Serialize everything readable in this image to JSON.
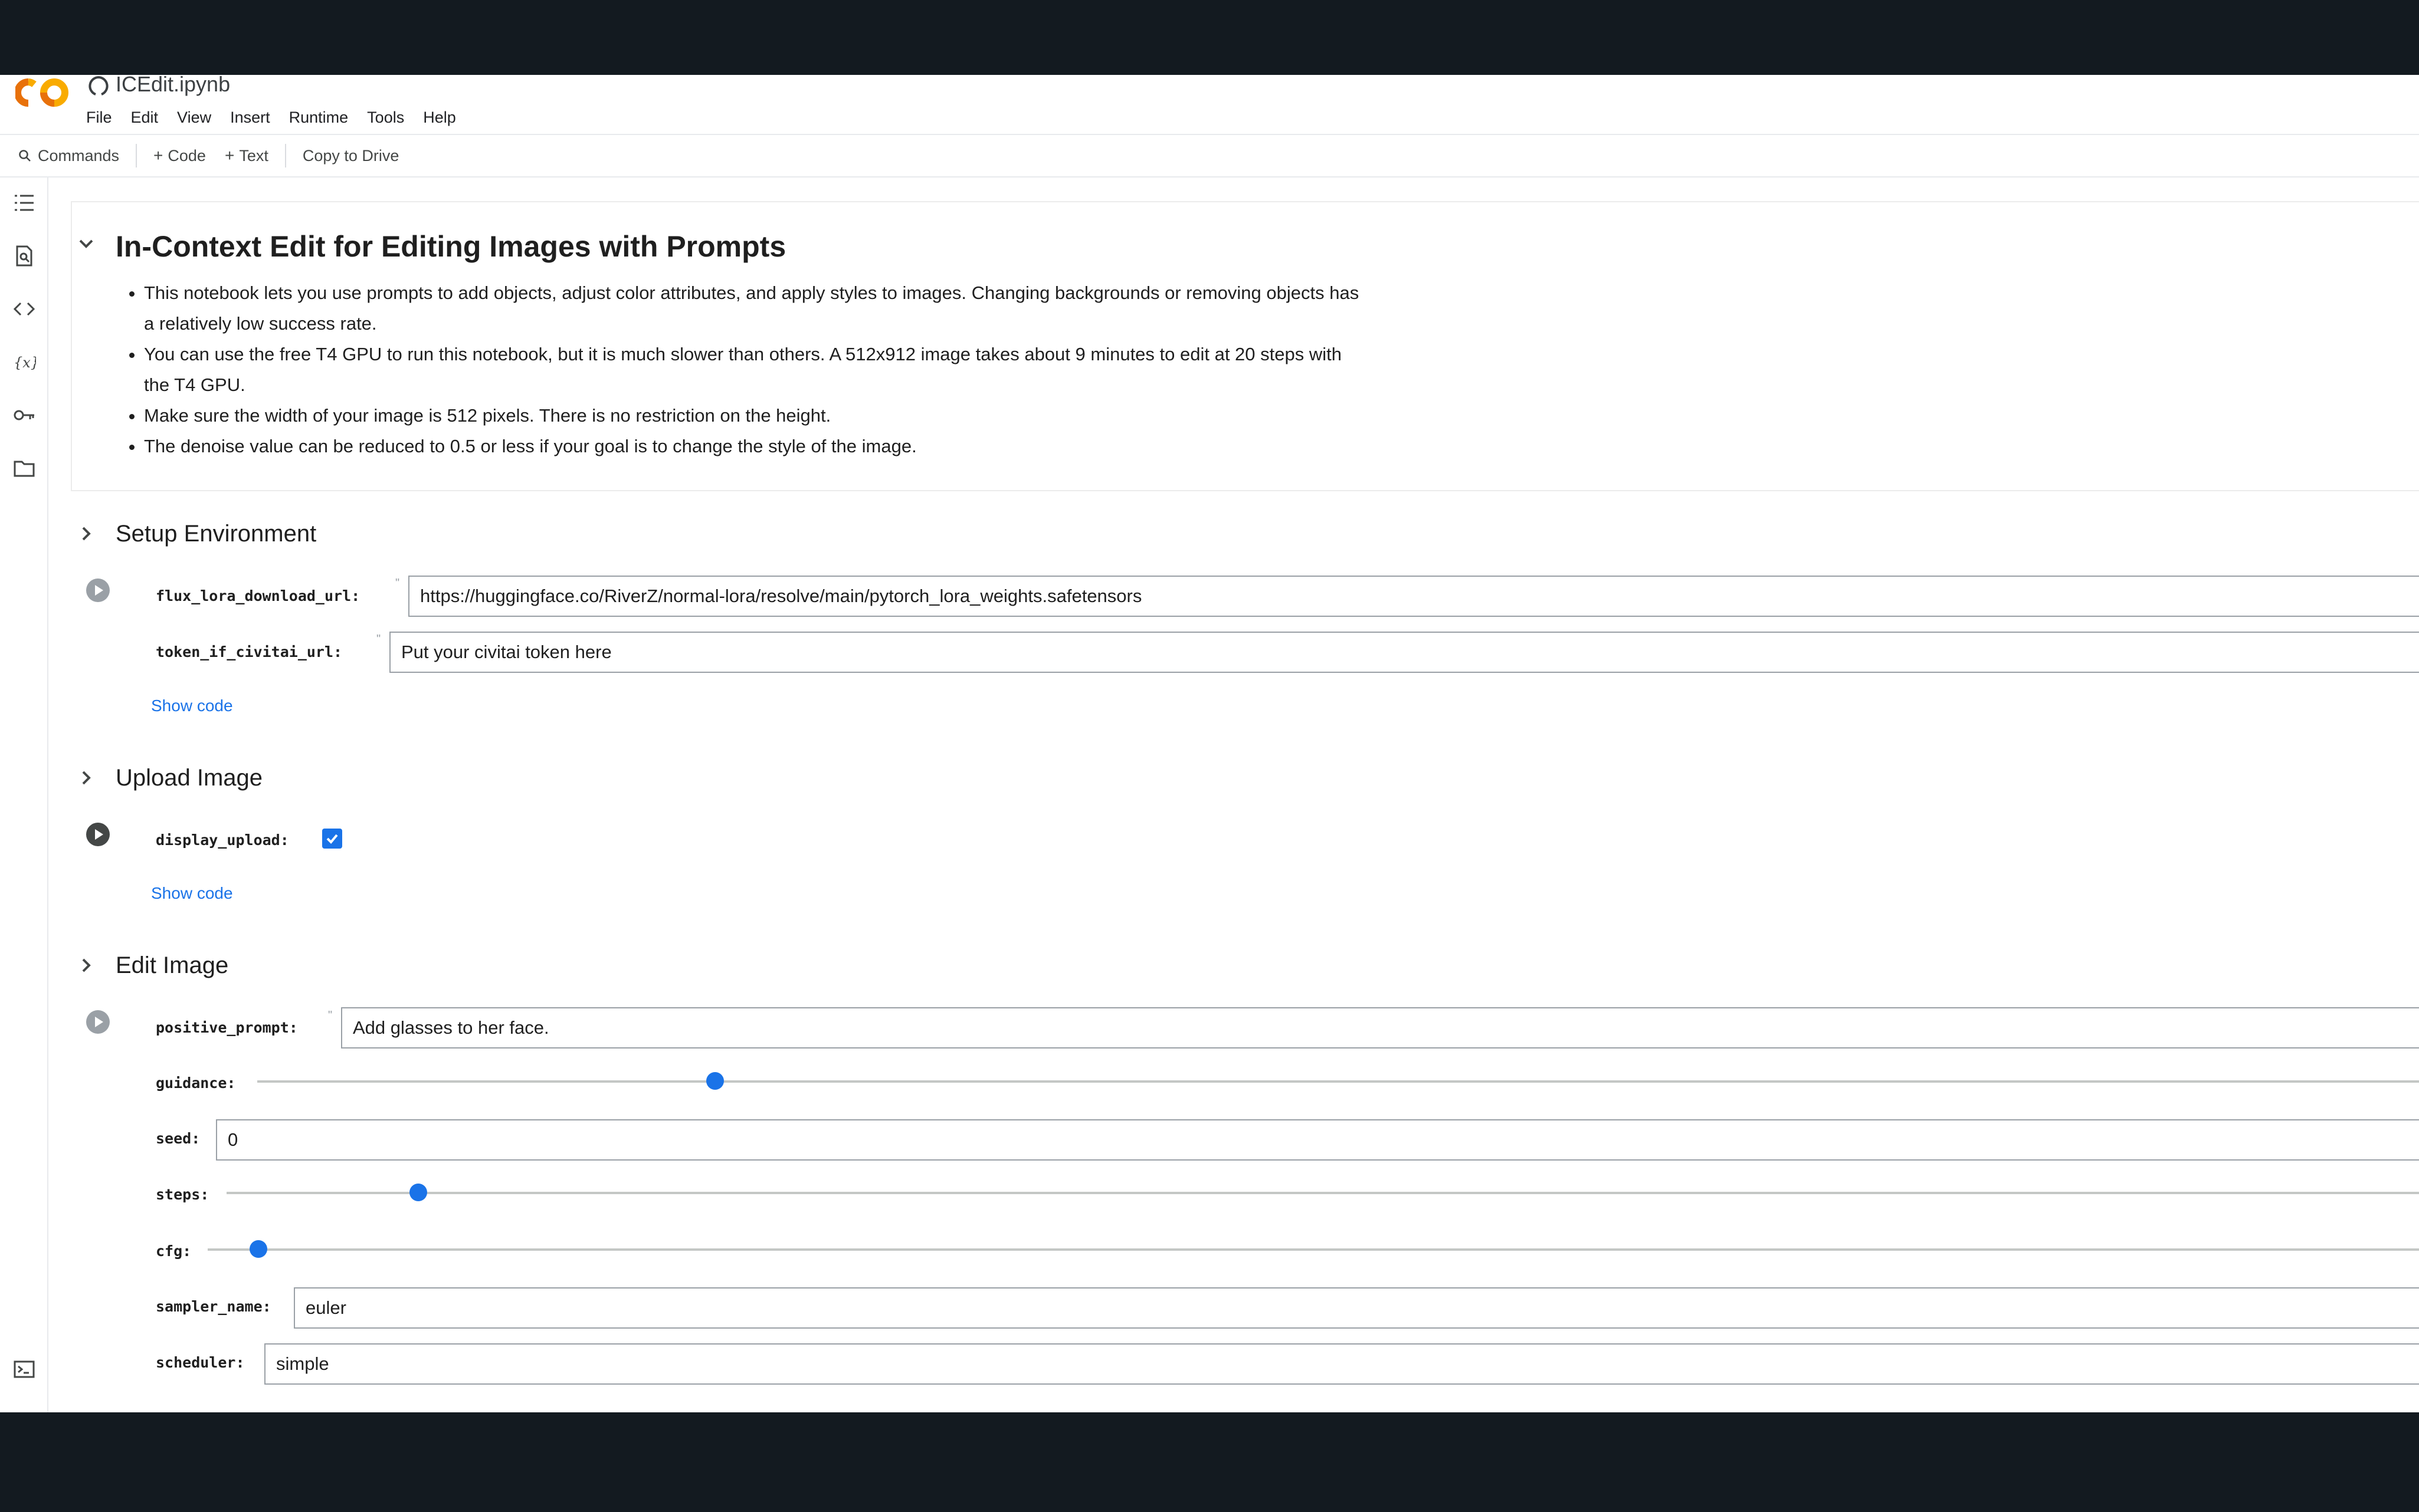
{
  "app": {
    "file_title": "ICEdit.ipynb"
  },
  "menu": [
    "File",
    "Edit",
    "View",
    "Insert",
    "Runtime",
    "Tools",
    "Help"
  ],
  "toolbar": {
    "commands": "Commands",
    "code": "Code",
    "text": "Text",
    "copy_to_drive": "Copy to Drive"
  },
  "intro": {
    "title": "In-Context Edit for Editing Images with Prompts",
    "bullets": [
      "This notebook lets you use prompts to add objects, adjust color attributes, and apply styles to images. Changing backgrounds or removing objects has a relatively low success rate.",
      "You can use the free T4 GPU to run this notebook, but it is much slower than others. A 512x912 image takes about 9 minutes to edit at 20 steps with the T4 GPU.",
      "Make sure the width of your image is 512 pixels. There is no restriction on the height.",
      "The denoise value can be reduced to 0.5 or less if your goal is to change the style of the image."
    ]
  },
  "setup": {
    "title": "Setup Environment",
    "flux_label": "flux_lora_download_url:",
    "flux_value": "https://huggingface.co/RiverZ/normal-lora/resolve/main/pytorch_lora_weights.safetensors",
    "token_label": "token_if_civitai_url:",
    "token_value": "Put your civitai token here",
    "show_code": "Show code"
  },
  "upload": {
    "title": "Upload Image",
    "display_label": "display_upload:",
    "display_checked": true,
    "show_code": "Show code"
  },
  "edit": {
    "title": "Edit Image",
    "prompt_label": "positive_prompt:",
    "prompt_value": "Add glasses to her face.",
    "guidance_label": "guidance:",
    "guidance_fraction": 0.211,
    "seed_label": "seed:",
    "seed_value": "0",
    "steps_label": "steps:",
    "steps_fraction": 0.087,
    "cfg_label": "cfg:",
    "cfg_fraction": 0.023,
    "sampler_label": "sampler_name:",
    "sampler_value": "euler",
    "scheduler_label": "scheduler:",
    "scheduler_value": "simple"
  },
  "colors": {
    "accent": "#1a73e8",
    "logo_orange": "#f9ab00",
    "logo_dark_orange": "#e8710a"
  }
}
